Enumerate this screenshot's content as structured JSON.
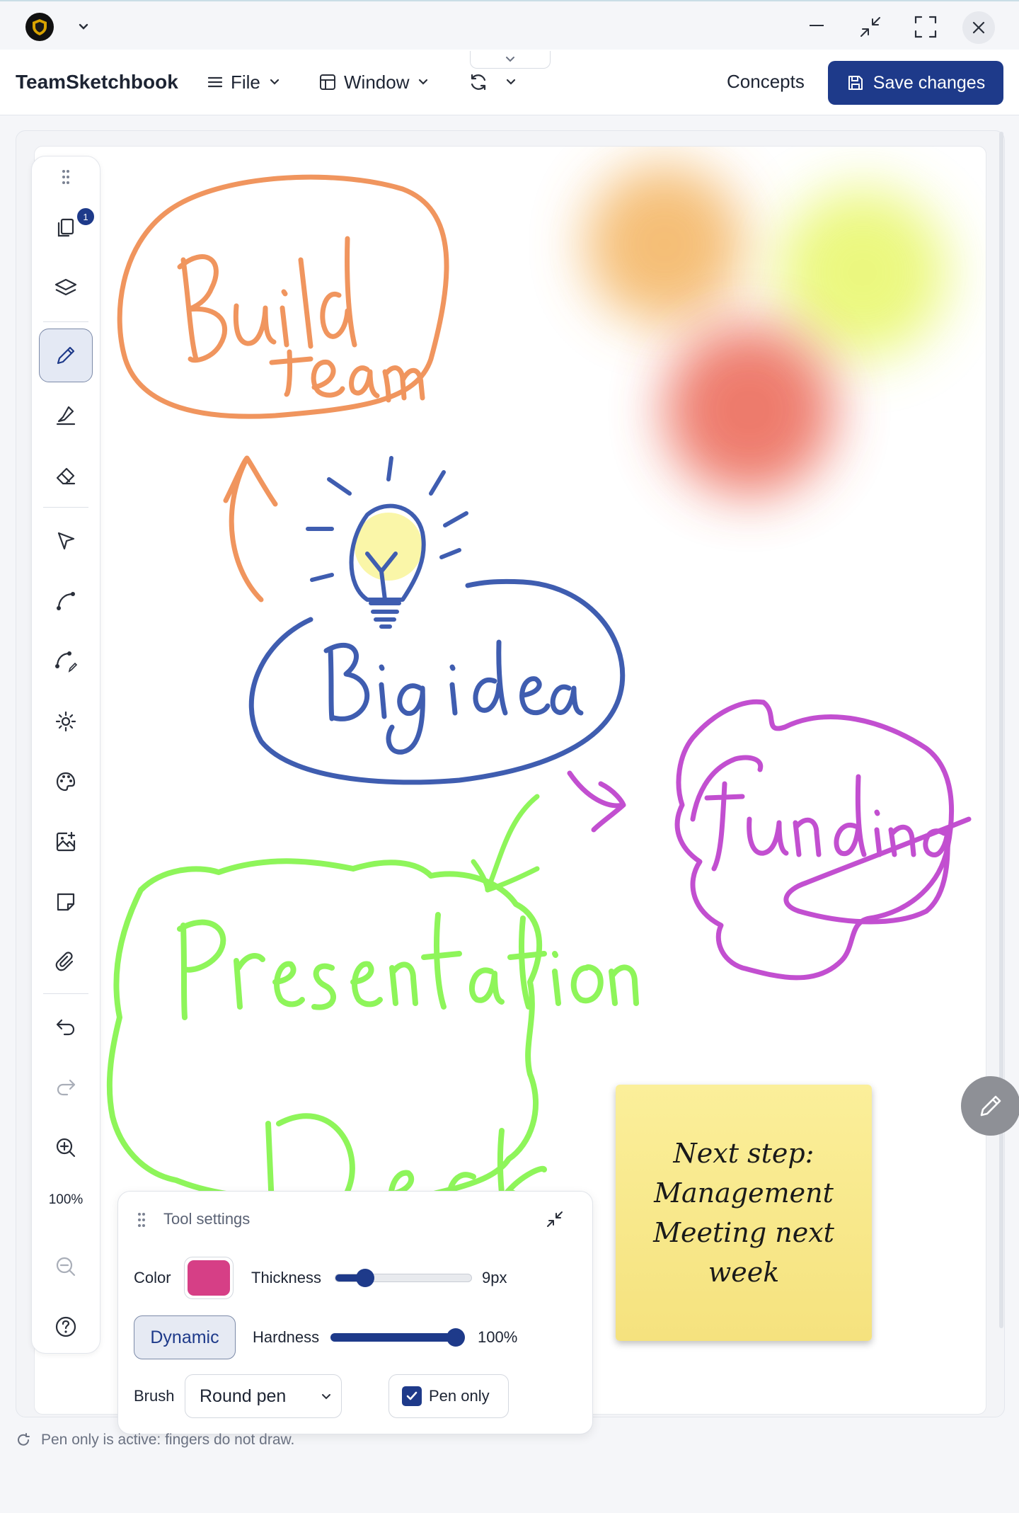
{
  "window": {
    "app_name": "TeamSketchbook"
  },
  "menu": {
    "file_label": "File",
    "window_label": "Window",
    "concepts_label": "Concepts",
    "save_label": "Save changes"
  },
  "toolbar": {
    "pages_badge": "1",
    "zoom_level": "100%",
    "tools": [
      "pages-icon",
      "layers-icon",
      "pen-icon",
      "highlighter-icon",
      "eraser-icon",
      "select-icon",
      "curve-icon",
      "curve-edit-icon",
      "brightness-icon",
      "palette-icon",
      "add-image-icon",
      "note-icon",
      "attachment-icon",
      "undo-icon",
      "redo-icon",
      "zoom-in-icon",
      "zoom-out-icon",
      "help-icon"
    ]
  },
  "sticky_note": {
    "line1": "Next step:",
    "line2": "Management",
    "line3": "Meeting next week"
  },
  "tool_settings": {
    "title": "Tool settings",
    "color_label": "Color",
    "color_value": "#d63f86",
    "thickness_label": "Thickness",
    "thickness_value": "9px",
    "thickness_level": 0.17,
    "dynamic_label": "Dynamic",
    "hardness_label": "Hardness",
    "hardness_value": "100%",
    "hardness_level": 1.0,
    "brush_label": "Brush",
    "brush_value": "Round pen",
    "pen_only_label": "Pen only",
    "pen_only_checked": true
  },
  "status": {
    "message": "Pen only is active: fingers do not draw."
  },
  "colors": {
    "accent": "#1e3a8a",
    "build_team": "#f0955e",
    "big_idea": "#3f5db0",
    "funding": "#c24fd0",
    "presentation": "#8ef55a"
  }
}
